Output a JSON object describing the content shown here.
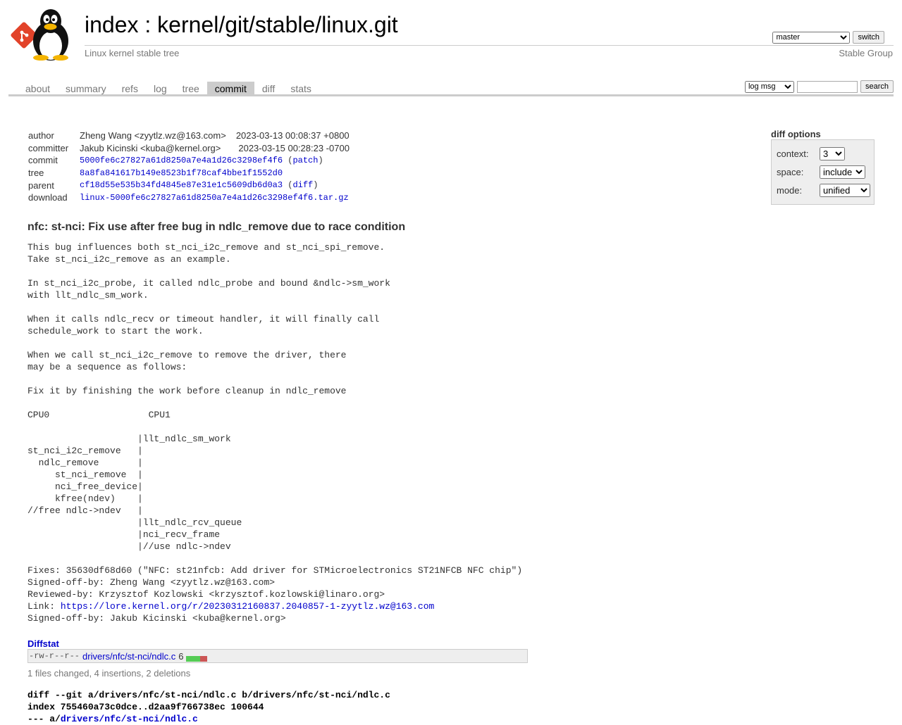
{
  "header": {
    "index_label": "index",
    "separator": " : ",
    "repo_path": "kernel/git/stable/linux.git",
    "subtitle": "Linux kernel stable tree",
    "owner": "Stable Group",
    "branch_selected": "master",
    "switch_label": "switch"
  },
  "tabs": [
    {
      "label": "about"
    },
    {
      "label": "summary"
    },
    {
      "label": "refs"
    },
    {
      "label": "log"
    },
    {
      "label": "tree"
    },
    {
      "label": "commit",
      "active": true
    },
    {
      "label": "diff"
    },
    {
      "label": "stats"
    }
  ],
  "search": {
    "type_selected": "log msg",
    "value": "",
    "button_label": "search"
  },
  "diff_options": {
    "title": "diff options",
    "context_label": "context:",
    "context_value": "3",
    "space_label": "space:",
    "space_value": "include",
    "mode_label": "mode:",
    "mode_value": "unified"
  },
  "commit_info": {
    "author_label": "author",
    "author": "Zheng Wang <zyytlz.wz@163.com>",
    "author_date": "2023-03-13 00:08:37 +0800",
    "committer_label": "committer",
    "committer": "Jakub Kicinski <kuba@kernel.org>",
    "committer_date": "2023-03-15 00:28:23 -0700",
    "commit_label": "commit",
    "commit_hash": "5000fe6c27827a61d8250a7e4a1d26c3298ef4f6",
    "patch_label": "patch",
    "tree_label": "tree",
    "tree_hash": "8a8fa841617b149e8523b1f78caf4bbe1f1552d0",
    "parent_label": "parent",
    "parent_hash": "cf18d55e535b34fd4845e87e31e1c5609db6d0a3",
    "diff_label": "diff",
    "download_label": "download",
    "download_file": "linux-5000fe6c27827a61d8250a7e4a1d26c3298ef4f6.tar.gz"
  },
  "subject": "nfc: st-nci: Fix use after free bug in ndlc_remove due to race condition",
  "message_body": "This bug influences both st_nci_i2c_remove and st_nci_spi_remove.\nTake st_nci_i2c_remove as an example.\n\nIn st_nci_i2c_probe, it called ndlc_probe and bound &ndlc->sm_work\nwith llt_ndlc_sm_work.\n\nWhen it calls ndlc_recv or timeout handler, it will finally call\nschedule_work to start the work.\n\nWhen we call st_nci_i2c_remove to remove the driver, there\nmay be a sequence as follows:\n\nFix it by finishing the work before cleanup in ndlc_remove\n\nCPU0                  CPU1\n\n                    |llt_ndlc_sm_work\nst_nci_i2c_remove   |\n  ndlc_remove       |\n     st_nci_remove  |\n     nci_free_device|\n     kfree(ndev)    |\n//free ndlc->ndev   |\n                    |llt_ndlc_rcv_queue\n                    |nci_recv_frame\n                    |//use ndlc->ndev\n\nFixes: 35630df68d60 (\"NFC: st21nfcb: Add driver for STMicroelectronics ST21NFCB NFC chip\")\nSigned-off-by: Zheng Wang <zyytlz.wz@163.com>\nReviewed-by: Krzysztof Kozlowski <krzysztof.kozlowski@linaro.org>",
  "link_prefix": "Link: ",
  "link_url": "https://lore.kernel.org/r/20230312160837.2040857-1-zyytlz.wz@163.com",
  "message_tail": "Signed-off-by: Jakub Kicinski <kuba@kernel.org>",
  "diffstat": {
    "header": "Diffstat",
    "mode": "-rw-r--r--",
    "path": "drivers/nfc/st-nci/ndlc.c",
    "count": "6",
    "insertions": 4,
    "deletions": 2,
    "summary": "1 files changed, 4 insertions, 2 deletions"
  },
  "diff": {
    "line1": "diff --git a/drivers/nfc/st-nci/ndlc.c b/drivers/nfc/st-nci/ndlc.c",
    "line2": "index 755460a73c0dce..d2aa9f766738ec 100644",
    "line3_prefix": "--- a/",
    "line3_path": "drivers/nfc/st-nci/ndlc.c"
  },
  "colors": {
    "link": "#0000cc",
    "tab_active_bg": "#cccccc",
    "add": "#55cc55",
    "del": "#cc5555"
  }
}
